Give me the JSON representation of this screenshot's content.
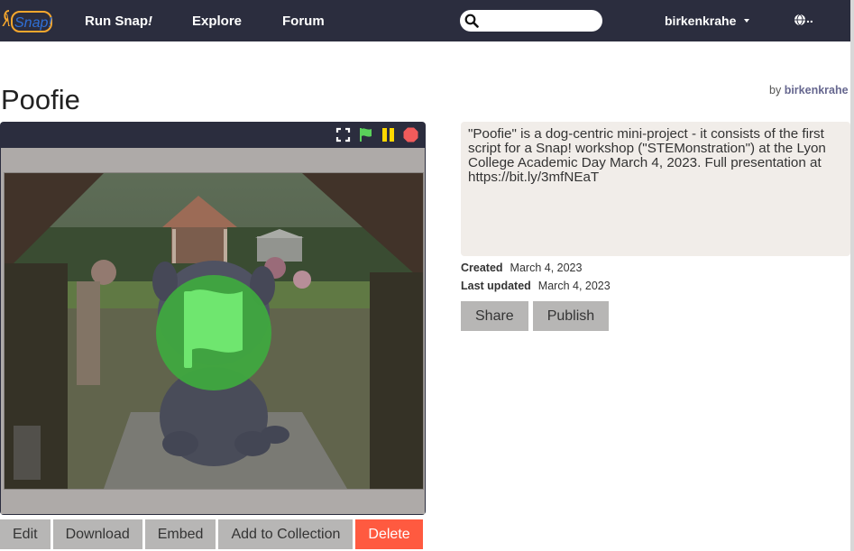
{
  "header": {
    "logo_text": "Snap!",
    "nav": [
      {
        "label": "Run Snap",
        "suffix": "!"
      },
      {
        "label": "Explore",
        "suffix": ""
      },
      {
        "label": "Forum",
        "suffix": ""
      }
    ],
    "search_placeholder": "",
    "username": "birkenkrahe",
    "lang_label": "..",
    "icons": {
      "search": "search-icon",
      "user_menu": "caret-down-icon",
      "language": "globe-icon"
    }
  },
  "project": {
    "title": "Poofie",
    "by_label": "by",
    "author": "birkenkrahe",
    "description": "\"Poofie\" is a dog-centric mini-project - it consists of the first script for a Snap! workshop (\"STEMonstration\") at the Lyon College Academic Day March 4, 2023. Full presentation at https://bit.ly/3mfNEaT",
    "created_label": "Created",
    "created": "March 4, 2023",
    "updated_label": "Last updated",
    "updated": "March 4, 2023"
  },
  "player": {
    "controls": [
      "fullscreen-icon",
      "green-flag-icon",
      "pause-icon",
      "stop-icon"
    ],
    "colors": {
      "flag": "#5ad15a",
      "pause": "#ffd700",
      "stop": "#f15b5b",
      "bar": "#2b2d3e"
    }
  },
  "actions": {
    "edit": "Edit",
    "download": "Download",
    "embed": "Embed",
    "add_to_collection": "Add to Collection",
    "delete": "Delete",
    "share": "Share",
    "publish": "Publish"
  }
}
